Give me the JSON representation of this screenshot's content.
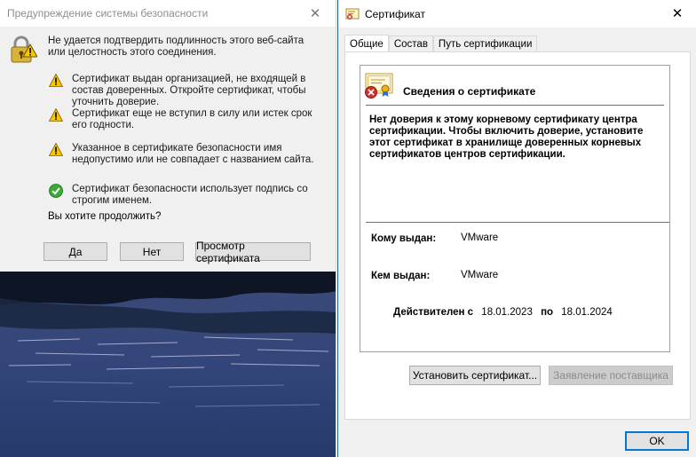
{
  "warning_dialog": {
    "title": "Предупреждение системы безопасности",
    "header_text": "Не удается подтвердить подлинность этого веб-сайта или целостность этого соединения.",
    "items": [
      {
        "icon": "warning-icon",
        "text": "Сертификат выдан организацией, не входящей в состав доверенных. Откройте сертификат, чтобы уточнить доверие."
      },
      {
        "icon": "warning-icon",
        "text": "Сертификат еще не вступил в силу или истек срок его годности."
      },
      {
        "icon": "warning-icon",
        "text": "Указанное в сертификате безопасности имя недопустимо или не совпадает с названием сайта."
      },
      {
        "icon": "check-icon",
        "text": "Сертификат безопасности использует подпись со строгим именем."
      }
    ],
    "question": "Вы хотите продолжить?",
    "buttons": {
      "yes": "Да",
      "no": "Нет",
      "view_cert": "Просмотр сертификата"
    }
  },
  "certificate_window": {
    "title": "Сертификат",
    "tabs": [
      "Общие",
      "Состав",
      "Путь сертификации"
    ],
    "active_tab": 0,
    "info_title": "Сведения о сертификате",
    "message": "Нет доверия к этому корневому сертификату центра сертификации. Чтобы включить  доверие, установите этот сертификат в хранилище доверенных корневых сертификатов центров сертификации.",
    "issued_to_label": "Кому выдан:",
    "issued_to": "VMware",
    "issued_by_label": "Кем выдан:",
    "issued_by": "VMware",
    "valid_from_label": "Действителен с",
    "valid_from": "18.01.2023",
    "valid_to_label": "по",
    "valid_to": "18.01.2024",
    "buttons": {
      "install": "Установить сертификат...",
      "issuer_statement": "Заявление поставщика",
      "ok": "OK"
    }
  },
  "colors": {
    "accent": "#0078d7",
    "warning_yellow": "#f7c600",
    "ok_green": "#3aa935",
    "error_red": "#d0312d"
  }
}
